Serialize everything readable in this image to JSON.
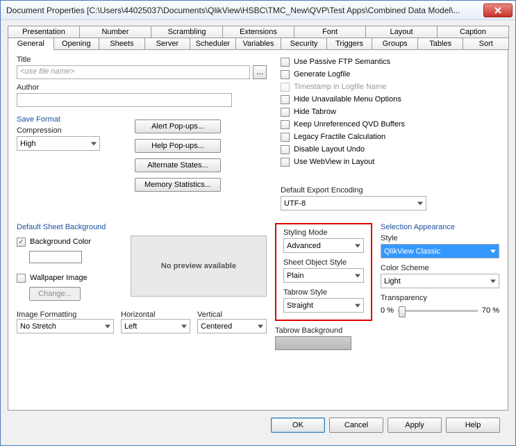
{
  "window": {
    "title": "Document Properties  [C:\\Users\\44025037\\Documents\\QlikView\\HSBC\\TMC_New\\QVP\\Test Apps\\Combined Data Model\\..."
  },
  "tabs_row1": [
    "Presentation",
    "Number",
    "Scrambling",
    "Extensions",
    "Font",
    "Layout",
    "Caption"
  ],
  "tabs_row2": [
    "General",
    "Opening",
    "Sheets",
    "Server",
    "Scheduler",
    "Variables",
    "Security",
    "Triggers",
    "Groups",
    "Tables",
    "Sort"
  ],
  "active_tab": "General",
  "labels": {
    "title": "Title",
    "title_placeholder": "<use file name>",
    "author": "Author",
    "save_format": "Save Format",
    "compression": "Compression",
    "default_sheet_bg": "Default Sheet Background",
    "background_color": "Background Color",
    "wallpaper_image": "Wallpaper Image",
    "change": "Change...",
    "no_preview": "No preview available",
    "image_formatting": "Image Formatting",
    "horizontal": "Horizontal",
    "vertical": "Vertical",
    "default_export_encoding": "Default Export Encoding",
    "styling_mode": "Styling Mode",
    "sheet_object_style": "Sheet Object Style",
    "tabrow_style": "Tabrow Style",
    "tabrow_background": "Tabrow Background",
    "selection_appearance": "Selection Appearance",
    "style": "Style",
    "color_scheme": "Color Scheme",
    "transparency": "Transparency",
    "transparency_min": "0 %",
    "transparency_max": "70 %"
  },
  "buttons": {
    "alert": "Alert Pop-ups...",
    "help": "Help Pop-ups...",
    "alternate": "Alternate States...",
    "memory": "Memory Statistics...",
    "ok": "OK",
    "cancel": "Cancel",
    "apply": "Apply",
    "helpbtn": "Help"
  },
  "compression_value": "High",
  "checkboxes": {
    "passive_ftp": "Use Passive FTP Semantics",
    "gen_logfile": "Generate Logfile",
    "timestamp_log": "Timestamp in Logfile Name",
    "hide_menu": "Hide Unavailable Menu Options",
    "hide_tabrow": "Hide Tabrow",
    "keep_qvd": "Keep Unreferenced QVD Buffers",
    "legacy_fractile": "Legacy Fractile Calculation",
    "disable_layout_undo": "Disable Layout Undo",
    "use_webview": "Use WebView in Layout"
  },
  "encoding_value": "UTF-8",
  "styling_mode_value": "Advanced",
  "sheet_object_style_value": "Plain",
  "tabrow_style_value": "Straight",
  "style_value": "QlikView Classic",
  "color_scheme_value": "Light",
  "image_formatting_value": "No Stretch",
  "horizontal_value": "Left",
  "vertical_value": "Centered"
}
